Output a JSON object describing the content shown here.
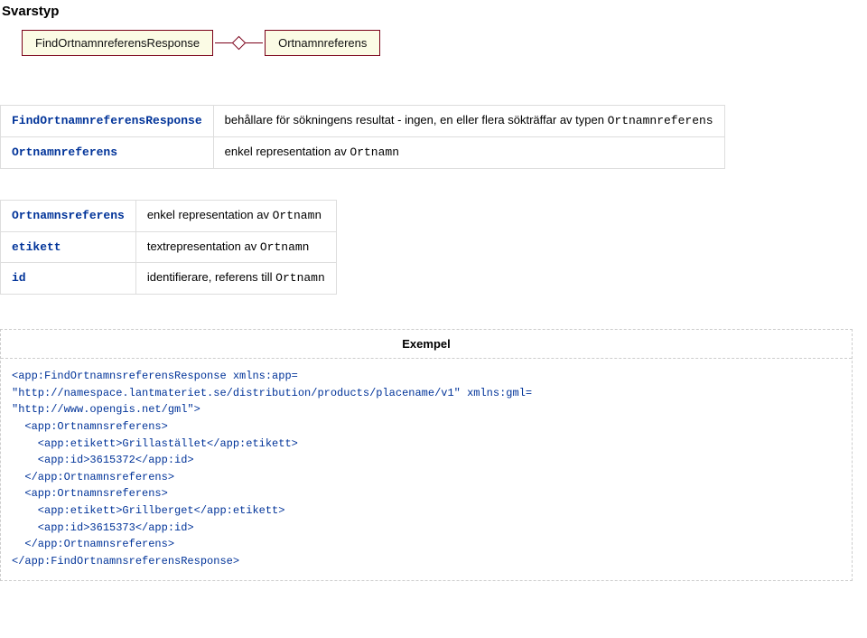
{
  "heading": "Svarstyp",
  "uml": {
    "box1": "FindOrtnamnreferensResponse",
    "box2": "Ortnamnreferens"
  },
  "table1": {
    "rows": [
      {
        "k": "FindOrtnamnreferensResponse",
        "v_pre": "behållare för sökningens resultat - ingen, en eller flera sökträffar av typen ",
        "v_code": "Ortnamnreferens"
      },
      {
        "k": "Ortnamnreferens",
        "v_pre": "enkel representation av ",
        "v_code": "Ortnamn"
      }
    ]
  },
  "table2": {
    "rows": [
      {
        "k": "Ortnamnsreferens",
        "v_pre": "enkel representation av ",
        "v_code": "Ortnamn"
      },
      {
        "k": "etikett",
        "v_pre": "textrepresentation av ",
        "v_code": "Ortnamn"
      },
      {
        "k": "id",
        "v_pre": "identifierare, referens till ",
        "v_code": "Ortnamn"
      }
    ]
  },
  "example": {
    "title": "Exempel",
    "lines": [
      "<app:FindOrtnamnsreferensResponse xmlns:app=",
      "\"http://namespace.lantmateriet.se/distribution/products/placename/v1\" xmlns:gml=",
      "\"http://www.opengis.net/gml\">",
      "  <app:Ortnamnsreferens>",
      "    <app:etikett>Grillastället</app:etikett>",
      "    <app:id>3615372</app:id>",
      "  </app:Ortnamnsreferens>",
      "  <app:Ortnamnsreferens>",
      "    <app:etikett>Grillberget</app:etikett>",
      "    <app:id>3615373</app:id>",
      "  </app:Ortnamnsreferens>",
      "</app:FindOrtnamnsreferensResponse>"
    ]
  }
}
